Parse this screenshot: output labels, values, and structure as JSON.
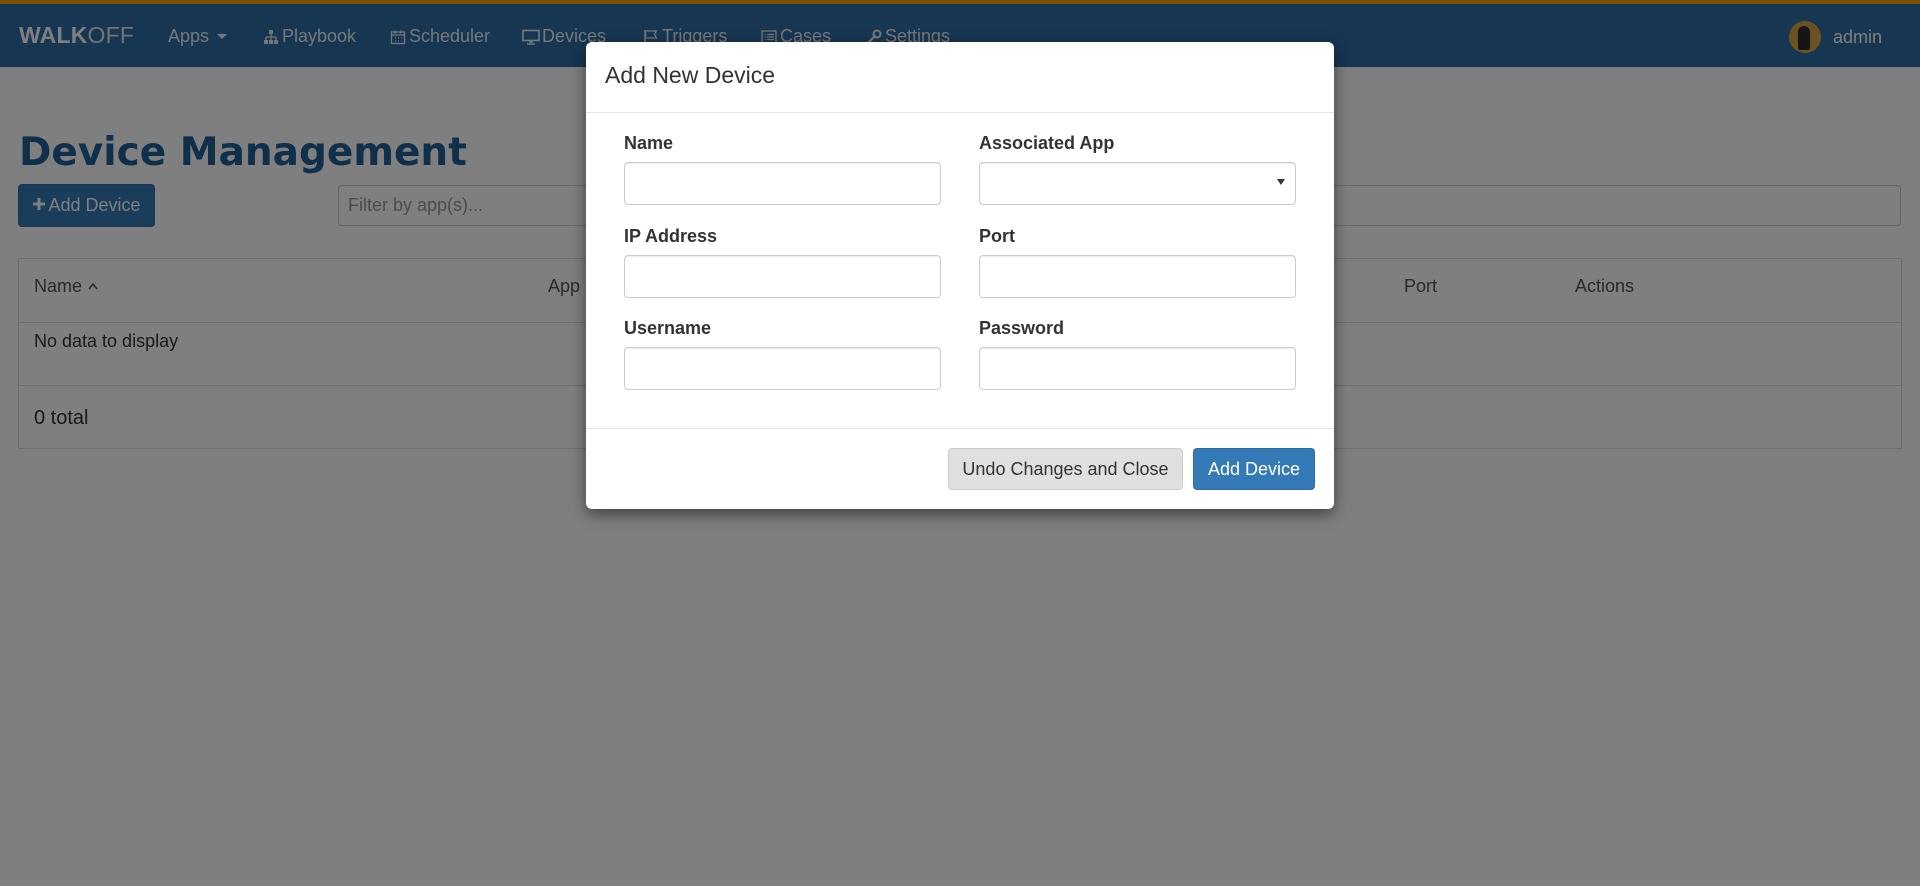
{
  "navbar": {
    "brand_bold": "WALK",
    "brand_light": "OFF",
    "items": [
      {
        "label": "Apps",
        "icon": "none",
        "dropdown": true
      },
      {
        "label": "Playbook",
        "icon": "sitemap-icon"
      },
      {
        "label": "Scheduler",
        "icon": "calendar-icon"
      },
      {
        "label": "Devices",
        "icon": "desktop-icon"
      },
      {
        "label": "Triggers",
        "icon": "flag-icon"
      },
      {
        "label": "Cases",
        "icon": "list-alt-icon"
      },
      {
        "label": "Settings",
        "icon": "wrench-icon"
      }
    ],
    "user": "admin"
  },
  "page": {
    "title": "Device Management",
    "add_button": "Add Device",
    "filter_placeholder": "Filter by app(s)..."
  },
  "table": {
    "columns": [
      "Name",
      "App",
      "Port",
      "Actions"
    ],
    "empty_message": "No data to display",
    "total": "0 total"
  },
  "modal": {
    "title": "Add New Device",
    "fields": {
      "name": {
        "label": "Name",
        "value": ""
      },
      "app": {
        "label": "Associated App",
        "value": ""
      },
      "ip": {
        "label": "IP Address",
        "value": ""
      },
      "port": {
        "label": "Port",
        "value": ""
      },
      "username": {
        "label": "Username",
        "value": ""
      },
      "password": {
        "label": "Password",
        "value": ""
      }
    },
    "undo_button": "Undo Changes and Close",
    "add_button": "Add Device"
  },
  "colors": {
    "navbar": "#2e6da4",
    "accent_stripe": "#f0a30a",
    "primary": "#337ab7",
    "title": "#1f5f95"
  }
}
